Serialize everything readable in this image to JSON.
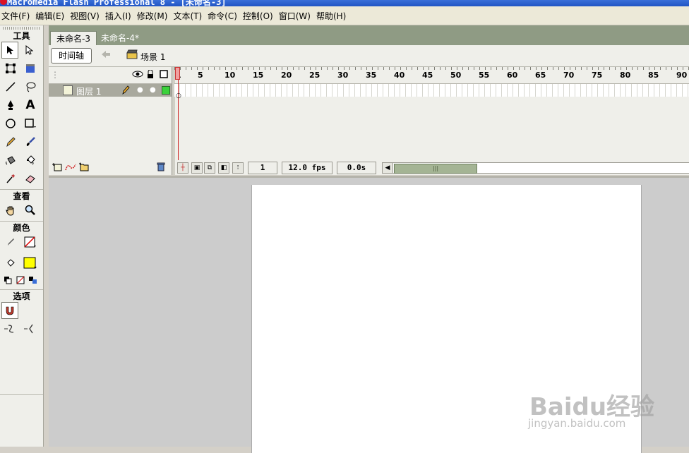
{
  "window": {
    "title": "Macromedia Flash Professional 8 - [未命名-3]"
  },
  "menu": [
    "文件(F)",
    "编辑(E)",
    "视图(V)",
    "插入(I)",
    "修改(M)",
    "文本(T)",
    "命令(C)",
    "控制(O)",
    "窗口(W)",
    "帮助(H)"
  ],
  "tools": {
    "title": "工具",
    "view_title": "查看",
    "color_title": "颜色",
    "options_title": "选项",
    "text_tool_glyph": "A"
  },
  "colors": {
    "fill": "#ffff00",
    "keyframe_layer": "#3bd23b",
    "playhead": "#cc2222"
  },
  "doc_tabs": [
    "未命名-3",
    "未命名-4*"
  ],
  "editbar": {
    "timeline_button": "时间轴",
    "scene": "场景 1"
  },
  "timeline": {
    "layer_name": "图层 1",
    "ruler": [
      "1",
      "5",
      "10",
      "15",
      "20",
      "25",
      "30",
      "35",
      "40",
      "45",
      "50",
      "55",
      "60",
      "65",
      "70",
      "75",
      "80",
      "85",
      "90"
    ],
    "current_frame": "1",
    "fps": "12.0 fps",
    "elapsed": "0.0s"
  },
  "watermark": {
    "brand": "Baidu经验",
    "url": "jingyan.baidu.com"
  }
}
